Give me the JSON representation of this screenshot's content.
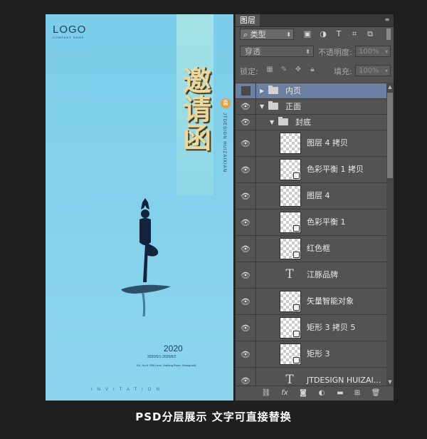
{
  "poster": {
    "logo": "LOGO",
    "logo_sub": "COMPANY NAME",
    "calligraphy": [
      "邀",
      "请",
      "函"
    ],
    "seal": "喜",
    "vertical_text": "JTDESIGN HUIZAIXIAN",
    "year": "2020",
    "date_range": "2020/6/1-2020/6/2",
    "address": "EA, No.8, 558 Lane, Haifang Road, ShanghaiA",
    "invitation": "INVITATION"
  },
  "panel": {
    "tab": "图层",
    "filter_kind": "类型",
    "blend_mode": "穿透",
    "opacity_label": "不透明度:",
    "opacity_value": "100%",
    "lock_label": "锁定:",
    "fill_label": "填充:",
    "fill_value": "100%",
    "layers": [
      {
        "name": "内页",
        "kind": "group",
        "visible": false,
        "selected": true,
        "indent": 0,
        "expanded": false
      },
      {
        "name": "正面",
        "kind": "group",
        "visible": true,
        "selected": false,
        "indent": 0,
        "expanded": true
      },
      {
        "name": "封底",
        "kind": "group",
        "visible": true,
        "selected": false,
        "indent": 1,
        "expanded": true
      },
      {
        "name": "图层 4 拷贝",
        "kind": "pixel"
      },
      {
        "name": "色彩平衡 1 拷贝",
        "kind": "smart"
      },
      {
        "name": "图层 4",
        "kind": "pixel"
      },
      {
        "name": "色彩平衡 1",
        "kind": "smart"
      },
      {
        "name": "红色框",
        "kind": "smart"
      },
      {
        "name": "江豚品牌",
        "kind": "text"
      },
      {
        "name": "矢量智能对象",
        "kind": "smart"
      },
      {
        "name": "矩形 3 拷贝 5",
        "kind": "shape"
      },
      {
        "name": "矩形 3",
        "kind": "shape"
      },
      {
        "name": "JTDESIGN HUIZAI...",
        "kind": "text"
      }
    ]
  },
  "caption": "PSD分层展示 文字可直接替换"
}
